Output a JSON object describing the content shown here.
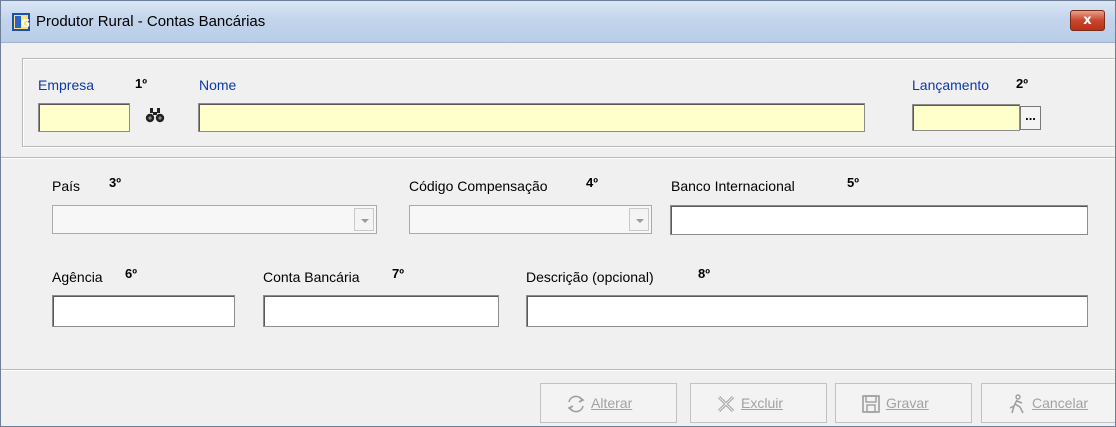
{
  "window": {
    "title": "Produtor Rural - Contas Bancárias",
    "close_label": "x"
  },
  "top": {
    "empresa_label": "Empresa",
    "empresa_order": "1º",
    "empresa_value": "",
    "nome_label": "Nome",
    "nome_value": "",
    "lancamento_label": "Lançamento",
    "lancamento_order": "2º",
    "lancamento_value": "",
    "lancamento_button": "...",
    "search_icon": "binoculars-icon"
  },
  "details": {
    "pais_label": "País",
    "pais_order": "3º",
    "pais_value": "",
    "codigo_label": "Código Compensação",
    "codigo_order": "4º",
    "codigo_value": "",
    "banco_label": "Banco Internacional",
    "banco_order": "5º",
    "banco_value": "",
    "agencia_label": "Agência",
    "agencia_order": "6º",
    "agencia_value": "",
    "conta_label": "Conta Bancária",
    "conta_order": "7º",
    "conta_value": "",
    "descricao_label": "Descrição (opcional)",
    "descricao_order": "8º",
    "descricao_value": ""
  },
  "buttons": {
    "alterar": "Alterar",
    "excluir": "Excluir",
    "gravar": "Gravar",
    "cancelar": "Cancelar"
  },
  "colors": {
    "label_blue": "#0b3aa8",
    "required_field": "#ffffcc",
    "disabled_text": "#a2a2a2"
  }
}
